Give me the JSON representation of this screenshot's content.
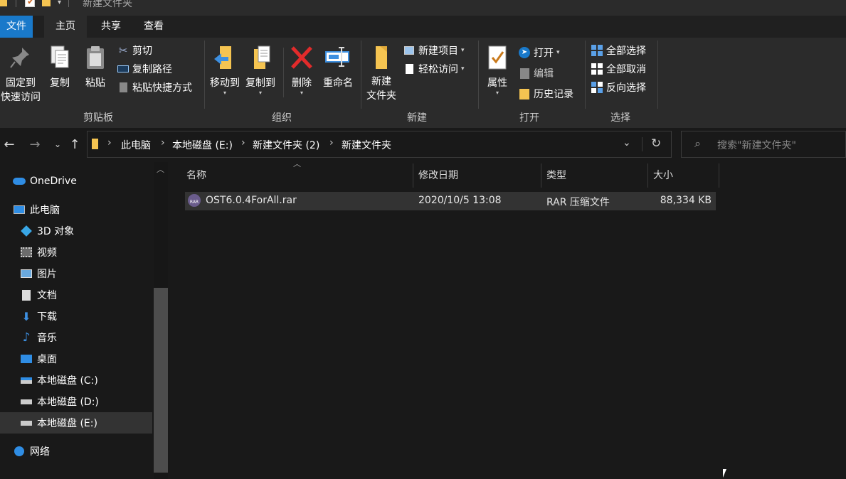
{
  "window": {
    "title": "新建文件夹"
  },
  "tabs": [
    {
      "label": "文件"
    },
    {
      "label": "主页"
    },
    {
      "label": "共享"
    },
    {
      "label": "查看"
    }
  ],
  "ribbon": {
    "clipboard": {
      "group": "剪贴板",
      "pin": "固定到\n快速访问",
      "copy": "复制",
      "paste": "粘贴",
      "cut": "剪切",
      "copy_path": "复制路径",
      "paste_shortcut": "粘贴快捷方式"
    },
    "organize": {
      "group": "组织",
      "move_to": "移动到",
      "copy_to": "复制到",
      "delete": "删除",
      "rename": "重命名"
    },
    "new": {
      "group": "新建",
      "new_folder": "新建\n文件夹",
      "new_item": "新建项目",
      "easy_access": "轻松访问"
    },
    "open": {
      "group": "打开",
      "properties": "属性",
      "open": "打开",
      "edit": "编辑",
      "history": "历史记录"
    },
    "select": {
      "group": "选择",
      "select_all": "全部选择",
      "select_none": "全部取消",
      "invert": "反向选择"
    }
  },
  "address": {
    "crumbs": [
      "此电脑",
      "本地磁盘 (E:)",
      "新建文件夹 (2)",
      "新建文件夹"
    ]
  },
  "search": {
    "placeholder": "搜索\"新建文件夹\""
  },
  "sidebar": {
    "items": [
      {
        "label": "OneDrive",
        "icon": "cloud-icon"
      },
      {
        "label": "此电脑",
        "icon": "computer-icon"
      },
      {
        "label": "3D 对象",
        "icon": "cube-icon"
      },
      {
        "label": "视频",
        "icon": "video-icon"
      },
      {
        "label": "图片",
        "icon": "picture-icon"
      },
      {
        "label": "文档",
        "icon": "document-icon"
      },
      {
        "label": "下载",
        "icon": "download-icon"
      },
      {
        "label": "音乐",
        "icon": "music-icon"
      },
      {
        "label": "桌面",
        "icon": "desktop-icon"
      },
      {
        "label": "本地磁盘 (C:)",
        "icon": "drive-icon"
      },
      {
        "label": "本地磁盘 (D:)",
        "icon": "drive-icon"
      },
      {
        "label": "本地磁盘 (E:)",
        "icon": "drive-icon"
      },
      {
        "label": "网络",
        "icon": "network-icon"
      }
    ]
  },
  "columns": {
    "name": "名称",
    "date": "修改日期",
    "type": "类型",
    "size": "大小"
  },
  "files": [
    {
      "name": "OST6.0.4ForAll.rar",
      "date": "2020/10/5 13:08",
      "type": "RAR 压缩文件",
      "size": "88,334 KB"
    }
  ],
  "colors": {
    "accent": "#1979ca",
    "folder": "#f5c451",
    "delete": "#e22b2b"
  }
}
